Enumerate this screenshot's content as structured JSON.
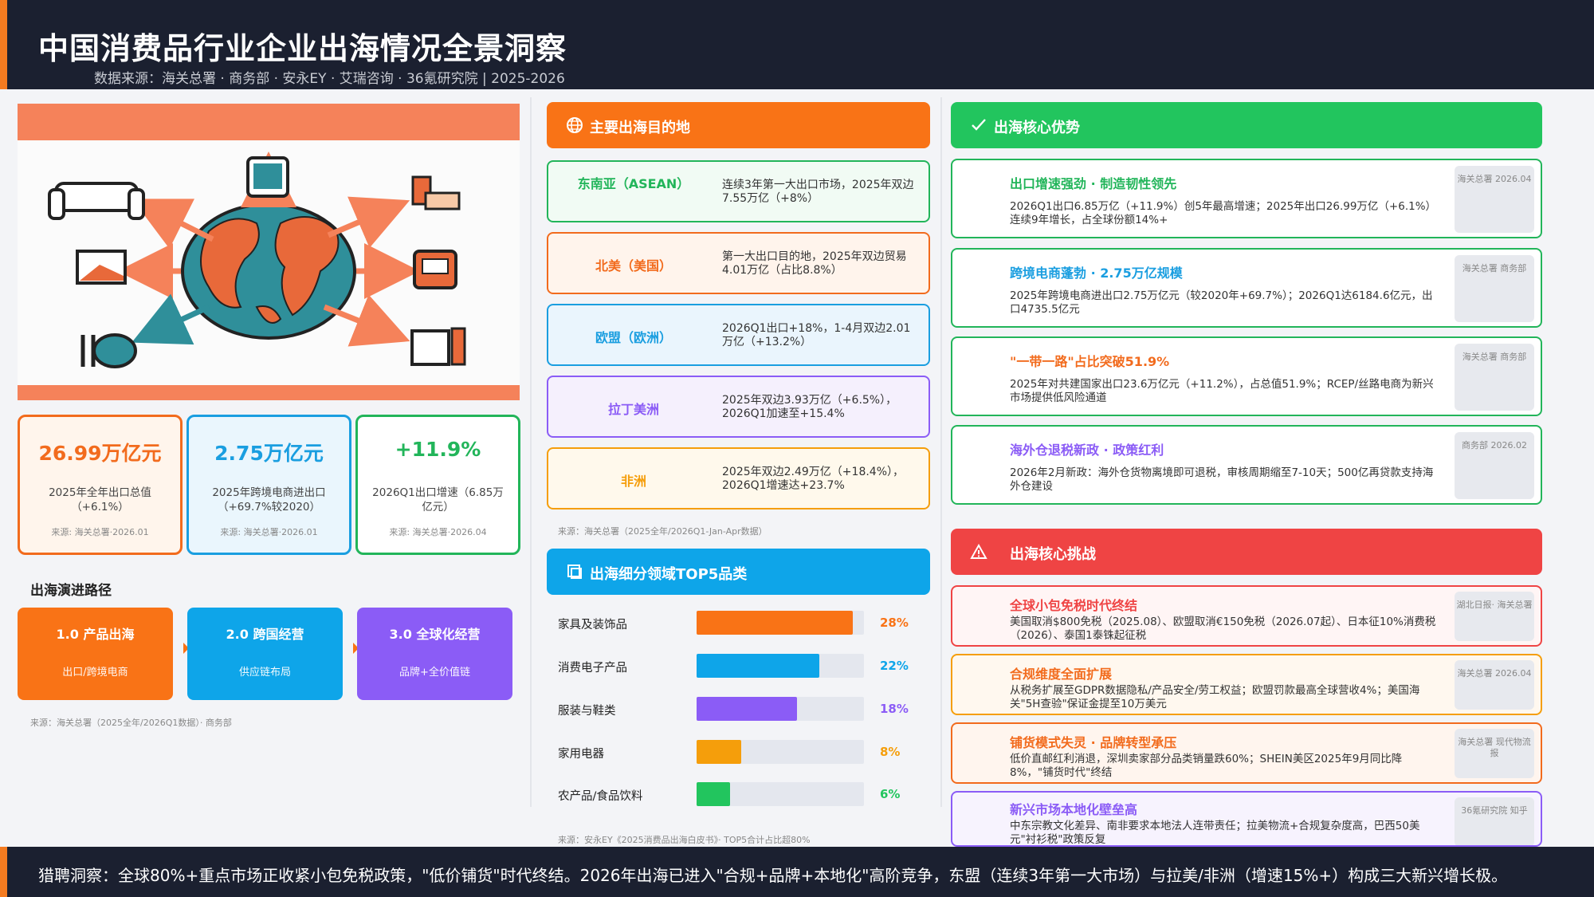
{
  "header": {
    "title": "中国消费品行业企业出海情况全景洞察",
    "subtitle": "数据来源：海关总署 · 商务部 · 安永EY · 艾瑞咨询 · 36氪研究院 | 2025-2026"
  },
  "stats": [
    {
      "value": "26.99万亿元",
      "desc": "2025年全年出口总值（+6.1%）",
      "source": "来源: 海关总署·2026.01",
      "color": "#f26b1d",
      "bg": "#fff5ec"
    },
    {
      "value": "2.75万亿元",
      "desc": "2025年跨境电商进出口（+69.7%较2020）",
      "source": "来源: 海关总署·2026.01",
      "color": "#1a9ee0",
      "bg": "#eaf6fd"
    },
    {
      "value": "+11.9%",
      "desc": "2026Q1出口增速（6.85万亿元）",
      "source": "来源: 海关总署·2026.04",
      "color": "#22b55a",
      "bg": "#ffffff"
    }
  ],
  "path": {
    "label": "出海演进路径",
    "stages": [
      {
        "title": "1.0 产品出海",
        "desc": "出口/跨境电商",
        "color": "#f97316"
      },
      {
        "title": "2.0 跨国经营",
        "desc": "供应链布局",
        "color": "#0ea5e9"
      },
      {
        "title": "3.0 全球化经营",
        "desc": "品牌+全价值链",
        "color": "#8b5cf6"
      }
    ],
    "source": "来源：海关总署（2025全年/2026Q1数据）· 商务部"
  },
  "destinations": {
    "title": "主要出海目的地",
    "items": [
      {
        "name": "东南亚（ASEAN）",
        "desc": "连续3年第一大出口市场，2025年双边7.55万亿（+8%）",
        "color": "#22b55a",
        "bg": "#f1fbf4"
      },
      {
        "name": "北美（美国）",
        "desc": "第一大出口目的地，2025年双边贸易4.01万亿（占比8.8%）",
        "color": "#f26b1d",
        "bg": "#fff4ec"
      },
      {
        "name": "欧盟（欧洲）",
        "desc": "2026Q1出口+18%，1-4月双边2.01万亿（+13.2%）",
        "color": "#1a9ee0",
        "bg": "#eaf5fd"
      },
      {
        "name": "拉丁美洲",
        "desc": "2025年双边3.93万亿（+6.5%），2026Q1加速至+15.4%",
        "color": "#8b5cf6",
        "bg": "#f5f0fd"
      },
      {
        "name": "非洲",
        "desc": "2025年双边2.49万亿（+18.4%），2026Q1增速达+23.7%",
        "color": "#f59e0b",
        "bg": "#fff9ec"
      }
    ],
    "source": "来源：海关总署（2025全年/2026Q1-Jan-Apr数据）"
  },
  "top5": {
    "title": "出海细分领域TOP5品类",
    "source": "来源：安永EY《2025消费品出海白皮书》· TOP5合计占比超80%"
  },
  "chart_data": {
    "type": "bar",
    "title": "出海细分领域TOP5品类",
    "categories": [
      "家具及装饰品",
      "消费电子产品",
      "服装与鞋类",
      "家用电器",
      "农产品/食品饮料"
    ],
    "values": [
      28,
      22,
      18,
      8,
      6
    ],
    "labels": [
      "28%",
      "22%",
      "18%",
      "8%",
      "6%"
    ],
    "colors": [
      "#f97316",
      "#0ea5e9",
      "#8b5cf6",
      "#f59e0b",
      "#22c55e"
    ],
    "xlim": [
      0,
      30
    ]
  },
  "advantages": {
    "title": "出海核心优势",
    "items": [
      {
        "title": "出口增速强劲 · 制造韧性领先",
        "desc": "2026Q1出口6.85万亿（+11.9%）创5年最高增速；2025年出口26.99万亿（+6.1%）连续9年增长，占全球份额14%+",
        "tag": "海关总署 2026.04",
        "color": "#22b55a"
      },
      {
        "title": "跨境电商蓬勃 · 2.75万亿规模",
        "desc": "2025年跨境电商进出口2.75万亿元（较2020年+69.7%）；2026Q1达6184.6亿元，出口4735.5亿元",
        "tag": "海关总署 商务部",
        "color": "#1a9ee0"
      },
      {
        "title": "\"一带一路\"占比突破51.9%",
        "desc": "2025年对共建国家出口23.6万亿元（+11.2%），占总值51.9%；RCEP/丝路电商为新兴市场提供低风险通道",
        "tag": "海关总署 商务部",
        "color": "#f26b1d"
      },
      {
        "title": "海外仓退税新政 · 政策红利",
        "desc": "2026年2月新政：海外仓货物离境即可退税，审核周期缩至7-10天；500亿再贷款支持海外仓建设",
        "tag": "商务部 2026.02",
        "color": "#8b5cf6"
      }
    ]
  },
  "challenges": {
    "title": "出海核心挑战",
    "items": [
      {
        "title": "全球小包免税时代终结",
        "desc": "美国取消$800免税（2025.08）、欧盟取消€150免税（2026.07起）、日本征10%消费税（2026）、泰国1泰铢起征税",
        "tag": "湖北日报· 海关总署",
        "color": "#ef4444",
        "bg": "#fff5f5"
      },
      {
        "title": "合规维度全面扩展",
        "desc": "从税务扩展至GDPR数据隐私/产品安全/劳工权益；欧盟罚款最高全球营收4%；美国海关\"5H查验\"保证金提至10万美元",
        "tag": "海关总署 2026.04",
        "color": "#f26b1d",
        "bg": "#fff8ef"
      },
      {
        "title": "铺货模式失灵 · 品牌转型承压",
        "desc": "低价直邮红利消退，深圳卖家部分品类销量跌60%；SHEIN美区2025年9月同比降8%，\"铺货时代\"终结",
        "tag": "海关总署 现代物流报",
        "color": "#f26b1d",
        "bg": "#fff5ee"
      },
      {
        "title": "新兴市场本地化壁垒高",
        "desc": "中东宗教文化差异、南非要求本地法人连带责任；拉美物流+合规复杂度高，巴西50美元\"衬衫税\"政策反复",
        "tag": "36氪研究院 知乎",
        "color": "#8b5cf6",
        "bg": "#f7f3fe"
      }
    ]
  },
  "footer": {
    "text": "猎聘洞察：全球80%+重点市场正收紧小包免税政策，\"低价铺货\"时代终结。2026年出海已进入\"合规+品牌+本地化\"高阶竞争，东盟（连续3年第一大市场）与拉美/非洲（增速15%+）构成三大新兴增长极。"
  }
}
